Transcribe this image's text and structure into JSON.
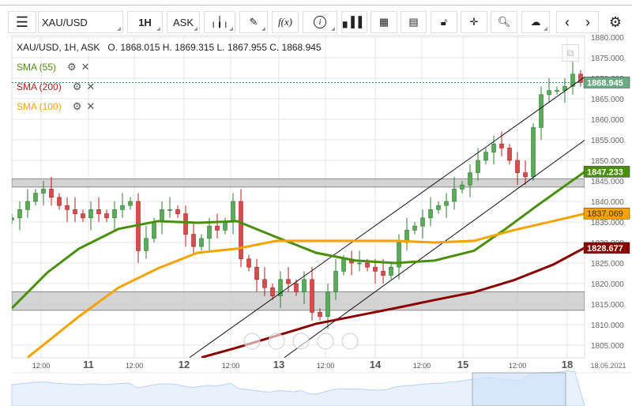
{
  "toolbar": {
    "menu_icon": "hamburger-icon",
    "symbol": "XAU/USD",
    "interval": "1H",
    "price_type": "ASK",
    "chart_type_icon": "candles-icon",
    "draw_icon": "pencil-icon",
    "indicator_label": "f(x)",
    "info_icon": "info-icon",
    "volume_icon": "bars-icon",
    "calendar_icon": "calendar-icon",
    "news_icon": "news-icon",
    "lock_icon": "lock-icon",
    "crosshair_icon": "crosshair-icon",
    "zoom_icon": "zoom-icon",
    "cloud_icon": "cloud-upload-icon",
    "prev_icon": "chevron-left-icon",
    "next_icon": "chevron-right-icon",
    "settings_icon": "gear-icon"
  },
  "info_line": "XAU/USD, 1H, ASK   O. 1868.015 H. 1869.315 L. 1867.955 C. 1868.945",
  "legend": [
    {
      "label": "SMA (55)",
      "color": "#4a8f0c"
    },
    {
      "label": "SMA (200)",
      "color": "#b01c1c"
    },
    {
      "label": "SMA (100)",
      "color": "#f5a300"
    }
  ],
  "chart_data": {
    "type": "candlestick",
    "ylim": [
      1802,
      1881
    ],
    "yticks": [
      1880,
      1875,
      1870,
      1865,
      1860,
      1855,
      1850,
      1845,
      1840,
      1835,
      1830,
      1825,
      1820,
      1815,
      1810,
      1805
    ],
    "ytick_labels": [
      "1880.000",
      "1875.000",
      "1870.000",
      "1865.000",
      "1860.000",
      "1855.000",
      "1850.000",
      "1845.000",
      "1840.000",
      "1835.000",
      "1830.000",
      "1825.000",
      "1820.000",
      "1815.000",
      "1810.000",
      "1805.000"
    ],
    "xticks": [
      {
        "i": 3.7,
        "label": "12:00",
        "major": false
      },
      {
        "i": 9.7,
        "label": "11",
        "major": true
      },
      {
        "i": 15.5,
        "label": "12:00",
        "major": false
      },
      {
        "i": 21.8,
        "label": "12",
        "major": true
      },
      {
        "i": 27.7,
        "label": "12:00",
        "major": false
      },
      {
        "i": 33.8,
        "label": "13",
        "major": true
      },
      {
        "i": 39.7,
        "label": "12:00",
        "major": false
      },
      {
        "i": 46,
        "label": "14",
        "major": true
      },
      {
        "i": 51.9,
        "label": "12:00",
        "major": false
      },
      {
        "i": 57.1,
        "label": "15",
        "major": true
      },
      {
        "i": 64,
        "label": "12:00",
        "major": false
      },
      {
        "i": 70.3,
        "label": "18",
        "major": true
      }
    ],
    "date_label": "18.05.2021",
    "closes": [
      1836,
      1838,
      1840,
      1842,
      1843,
      1841,
      1839,
      1838,
      1837,
      1836,
      1838,
      1837,
      1836,
      1838,
      1839,
      1840,
      1828,
      1831,
      1835,
      1838,
      1838,
      1837,
      1832,
      1829,
      1831,
      1834,
      1833,
      1835,
      1840,
      1826,
      1824,
      1821,
      1819,
      1817,
      1821,
      1820,
      1818,
      1821,
      1813,
      1812,
      1818,
      1823,
      1826,
      1825,
      1825,
      1824,
      1823,
      1822,
      1824,
      1830,
      1833,
      1834,
      1836,
      1838,
      1839,
      1840,
      1843,
      1844,
      1847,
      1850,
      1852,
      1854,
      1853,
      1850,
      1847,
      1846,
      1858,
      1866,
      1867,
      1867,
      1868,
      1871,
      1868.945
    ],
    "series": [
      {
        "name": "SMA (55)",
        "color": "#4a8f0c",
        "last": "1847.233",
        "points": [
          [
            0,
            1814
          ],
          [
            4.5,
            1822.7
          ],
          [
            8.5,
            1828.5
          ],
          [
            13.5,
            1833.3
          ],
          [
            18.5,
            1835.2
          ],
          [
            23.5,
            1834.8
          ],
          [
            28.5,
            1835.2
          ],
          [
            33.5,
            1831.3
          ],
          [
            38.5,
            1827.5
          ],
          [
            43.5,
            1825.6
          ],
          [
            48.5,
            1825
          ],
          [
            53.5,
            1825.6
          ],
          [
            58.5,
            1828
          ],
          [
            62.5,
            1833.3
          ],
          [
            66.5,
            1839
          ],
          [
            72.5,
            1847.2
          ]
        ]
      },
      {
        "name": "SMA (100)",
        "color": "#f5a300",
        "last": "1837.069",
        "points": [
          [
            2,
            1802
          ],
          [
            8.5,
            1812
          ],
          [
            13.5,
            1819
          ],
          [
            18.5,
            1823.7
          ],
          [
            23.5,
            1827.5
          ],
          [
            28.5,
            1828.5
          ],
          [
            33.5,
            1830.4
          ],
          [
            43.5,
            1830.4
          ],
          [
            48.5,
            1830.4
          ],
          [
            53.5,
            1830
          ],
          [
            58.5,
            1830.4
          ],
          [
            63.5,
            1833
          ],
          [
            68.5,
            1835.2
          ],
          [
            72.5,
            1837
          ]
        ]
      },
      {
        "name": "SMA (200)",
        "color": "#8b0000",
        "last": "1828.677",
        "points": [
          [
            24,
            1802
          ],
          [
            28.5,
            1804.4
          ],
          [
            33.5,
            1807.3
          ],
          [
            38.5,
            1810.2
          ],
          [
            43.5,
            1812.1
          ],
          [
            48.5,
            1814
          ],
          [
            53.5,
            1816
          ],
          [
            58.5,
            1817.9
          ],
          [
            63.5,
            1820.8
          ],
          [
            68.5,
            1824.6
          ],
          [
            72.5,
            1828.7
          ]
        ]
      }
    ],
    "zones": [
      [
        1843.5,
        1845.5
      ],
      [
        1813.5,
        1818
      ]
    ],
    "trendlines": [
      [
        [
          22.5,
          1802
        ],
        [
          72.5,
          1870.3
        ]
      ],
      [
        [
          34.5,
          1802
        ],
        [
          72.5,
          1854.9
        ]
      ]
    ],
    "last_price": "1868.945"
  }
}
